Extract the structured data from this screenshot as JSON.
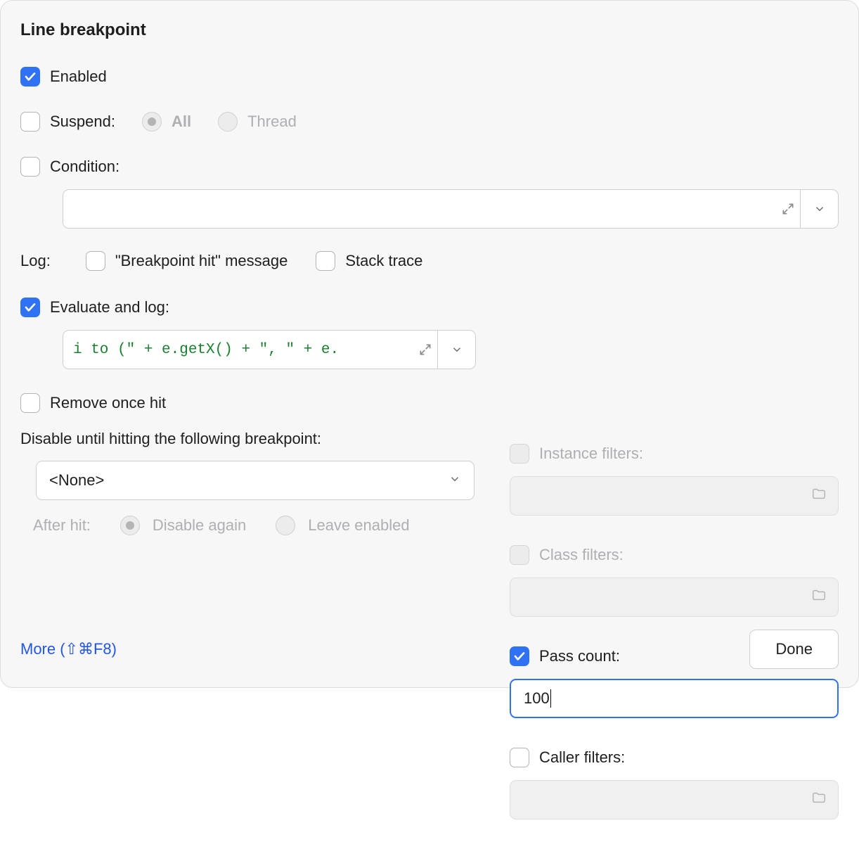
{
  "title": "Line breakpoint",
  "enabled": {
    "label": "Enabled",
    "checked": true
  },
  "suspend": {
    "label": "Suspend:",
    "checked": false,
    "options": {
      "all": "All",
      "thread": "Thread"
    },
    "selected": "all"
  },
  "condition": {
    "label": "Condition:",
    "checked": false,
    "value": ""
  },
  "log": {
    "label": "Log:",
    "bp_hit": {
      "label": "\"Breakpoint hit\" message",
      "checked": false
    },
    "stack": {
      "label": "Stack trace",
      "checked": false
    }
  },
  "eval_log": {
    "label": "Evaluate and log:",
    "checked": true,
    "expression": "i to (\" + e.getX() + \", \" + e."
  },
  "remove_once": {
    "label": "Remove once hit",
    "checked": false
  },
  "disable_until": {
    "label": "Disable until hitting the following breakpoint:",
    "selected": "<None>",
    "after_hit_label": "After hit:",
    "disable_again": "Disable again",
    "leave_enabled": "Leave enabled"
  },
  "instance_filters": {
    "label": "Instance filters:",
    "checked": false,
    "enabled": false
  },
  "class_filters": {
    "label": "Class filters:",
    "checked": false,
    "enabled": false
  },
  "pass_count": {
    "label": "Pass count:",
    "checked": true,
    "value": "100"
  },
  "caller_filters": {
    "label": "Caller filters:",
    "checked": false,
    "enabled": true
  },
  "footer": {
    "more_label": "More (⇧⌘F8)",
    "done_label": "Done"
  }
}
